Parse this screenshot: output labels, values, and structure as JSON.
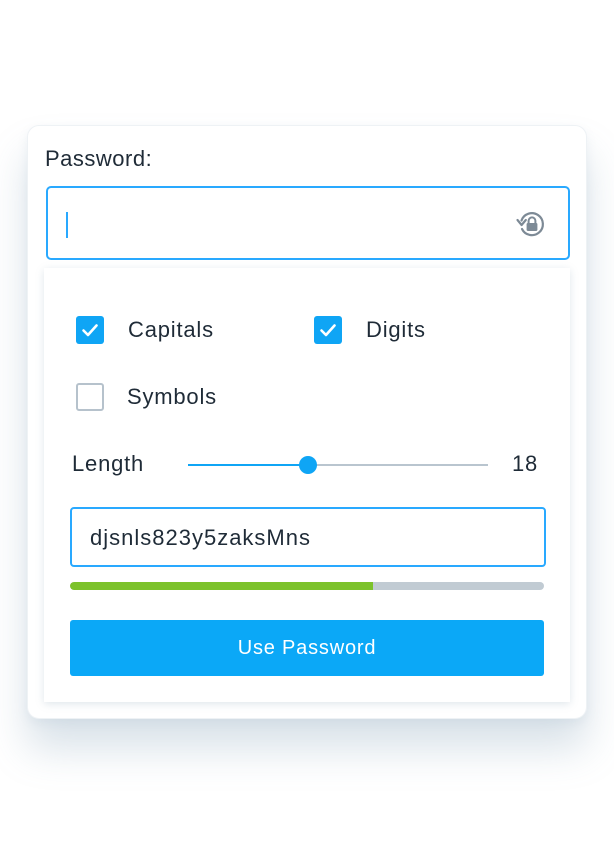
{
  "password": {
    "label": "Password:",
    "value": "",
    "reset_icon": "rotate-lock-icon"
  },
  "options": {
    "capitals": {
      "label": "Capitals",
      "checked": true
    },
    "digits": {
      "label": "Digits",
      "checked": true
    },
    "symbols": {
      "label": "Symbols",
      "checked": false
    }
  },
  "length": {
    "label": "Length",
    "value": "18",
    "slider_fraction": 0.4
  },
  "generated": {
    "value": "djsnls823y5zaksMns"
  },
  "strength": {
    "fraction": 0.64
  },
  "use_button": {
    "label": "Use Password"
  },
  "colors": {
    "accent": "#0fa5f5",
    "strength_good": "#7cc22b",
    "track": "#c1cbd3"
  }
}
